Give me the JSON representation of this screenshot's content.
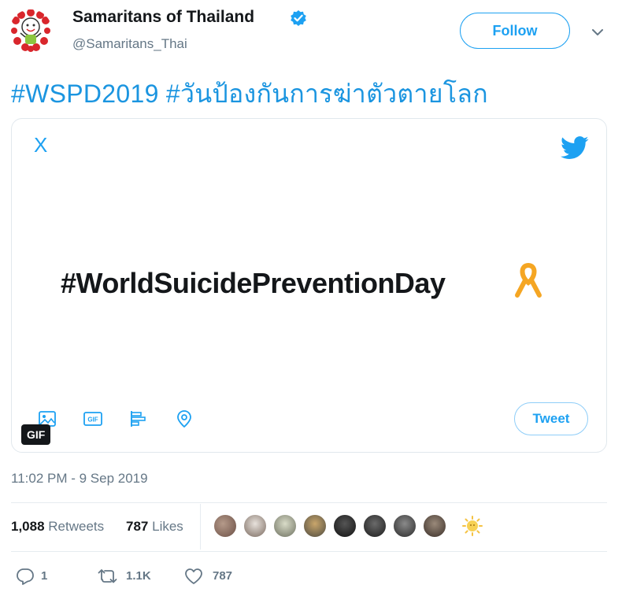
{
  "account": {
    "display_name": "Samaritans of Thailand",
    "handle": "@Samaritans_Thai",
    "verified": true,
    "follow_label": "Follow"
  },
  "tweet": {
    "text": "#WSPD2019 #วันป้องกันการฆ่าตัวตายโลก",
    "timestamp": "11:02 PM - 9 Sep 2019"
  },
  "gif_card": {
    "close_glyph": "X",
    "hashtag": "#WorldSuicidePreventionDay",
    "badge": "GIF",
    "toolbar_icons": [
      "image-icon",
      "gif-icon",
      "poll-icon",
      "location-icon"
    ],
    "tweet_button": "Tweet"
  },
  "stats": {
    "retweets_count": "1,088",
    "retweets_label": "Retweets",
    "likes_count": "787",
    "likes_label": "Likes"
  },
  "actions": {
    "replies": "1",
    "retweets": "1.1K",
    "likes": "787"
  },
  "colors": {
    "brand_blue": "#1da1f2",
    "link_blue": "#1b95e0",
    "ribbon_gold": "#f5a623"
  }
}
